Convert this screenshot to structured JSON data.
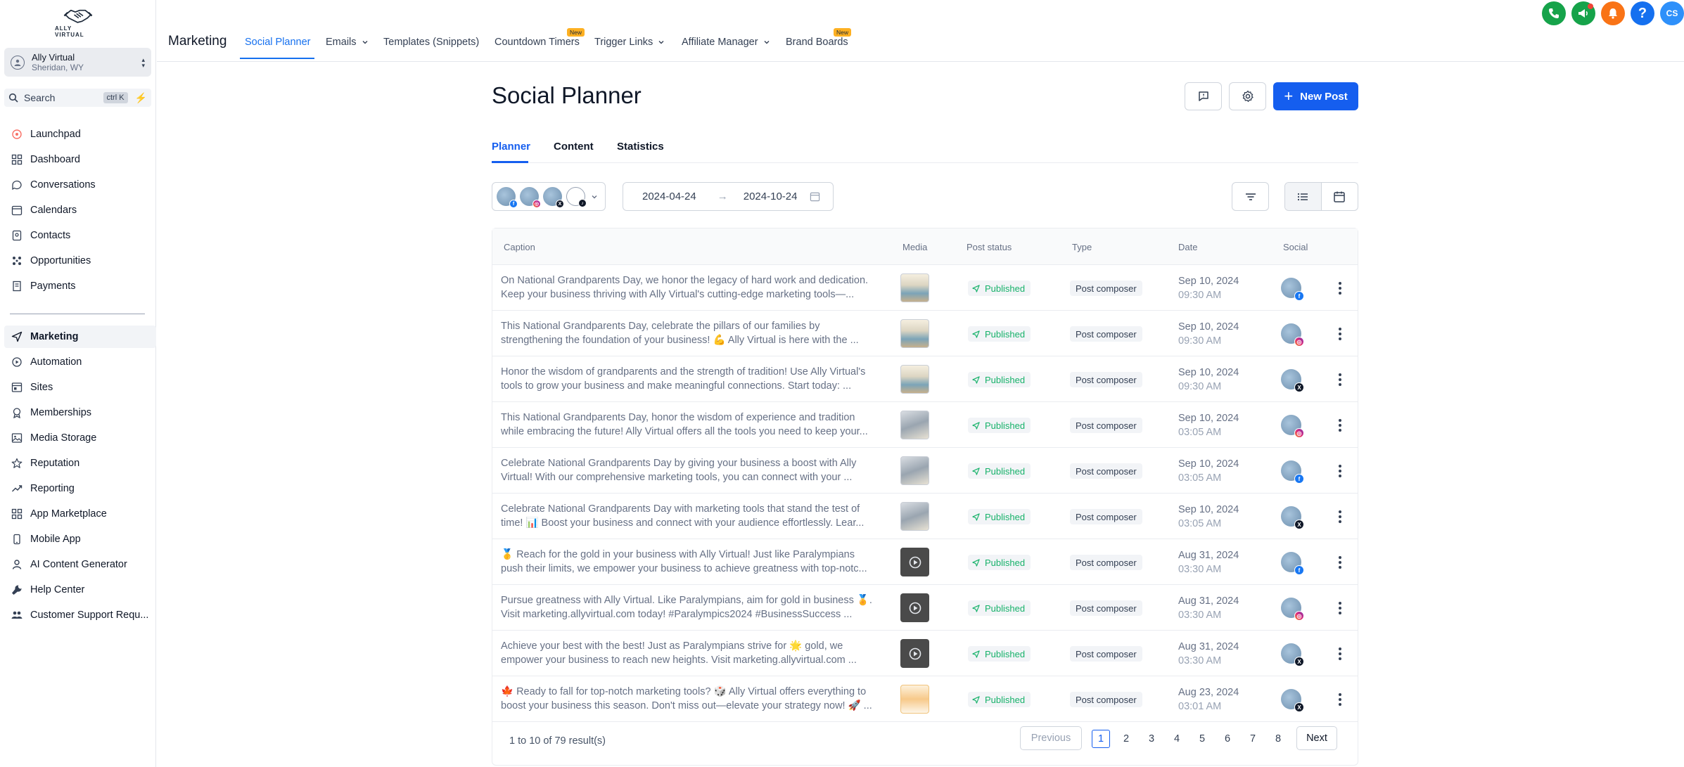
{
  "brand": {
    "logo_text": "ALLY VIRTUAL"
  },
  "account": {
    "name": "Ally Virtual",
    "location": "Sheridan, WY"
  },
  "search": {
    "label": "Search",
    "shortcut": "ctrl K"
  },
  "sidebar": {
    "items": [
      {
        "label": "Launchpad",
        "icon": "rocket-icon"
      },
      {
        "label": "Dashboard",
        "icon": "grid-icon"
      },
      {
        "label": "Conversations",
        "icon": "chat-icon"
      },
      {
        "label": "Calendars",
        "icon": "calendar-icon"
      },
      {
        "label": "Contacts",
        "icon": "contacts-icon"
      },
      {
        "label": "Opportunities",
        "icon": "opportunities-icon"
      },
      {
        "label": "Payments",
        "icon": "payments-icon"
      },
      {
        "label": "Marketing",
        "icon": "send-icon"
      },
      {
        "label": "Automation",
        "icon": "automation-icon"
      },
      {
        "label": "Sites",
        "icon": "sites-icon"
      },
      {
        "label": "Memberships",
        "icon": "memberships-icon"
      },
      {
        "label": "Media Storage",
        "icon": "image-icon"
      },
      {
        "label": "Reputation",
        "icon": "star-icon"
      },
      {
        "label": "Reporting",
        "icon": "trend-icon"
      },
      {
        "label": "App Marketplace",
        "icon": "apps-icon"
      },
      {
        "label": "Mobile App",
        "icon": "mobile-icon"
      },
      {
        "label": "AI Content Generator",
        "icon": "ai-icon"
      },
      {
        "label": "Help Center",
        "icon": "wrench-icon"
      },
      {
        "label": "Customer Support Requ...",
        "icon": "support-icon"
      }
    ],
    "active": "Marketing"
  },
  "topnav": {
    "module": "Marketing",
    "tabs": [
      {
        "label": "Social Planner"
      },
      {
        "label": "Emails"
      },
      {
        "label": "Templates (Snippets)"
      },
      {
        "label": "Countdown Timers"
      },
      {
        "label": "Trigger Links"
      },
      {
        "label": "Affiliate Manager"
      },
      {
        "label": "Brand Boards"
      }
    ],
    "new_badge": "New",
    "user_initials": "CS"
  },
  "page": {
    "title": "Social Planner",
    "new_post": "New Post",
    "subtabs": [
      "Planner",
      "Content",
      "Statistics"
    ],
    "date_start": "2024-04-24",
    "date_end": "2024-10-24"
  },
  "table": {
    "columns": [
      "Caption",
      "Media",
      "Post status",
      "Type",
      "Date",
      "Social"
    ],
    "rows": [
      {
        "caption1": "On National Grandparents Day, we honor the legacy of hard work and dedication.",
        "caption2": "Keep your business thriving with Ally Virtual's cutting-edge marketing tools—...",
        "media": "image",
        "status": "Published",
        "type": "Post composer",
        "date": "Sep 10, 2024",
        "time": "09:30 AM",
        "network": "fb"
      },
      {
        "caption1": "This National Grandparents Day, celebrate the pillars of our families by",
        "caption2": "strengthening the foundation of your business! 💪 Ally Virtual is here with the ...",
        "media": "image",
        "status": "Published",
        "type": "Post composer",
        "date": "Sep 10, 2024",
        "time": "09:30 AM",
        "network": "ig"
      },
      {
        "caption1": "Honor the wisdom of grandparents and the strength of tradition! Use Ally Virtual's",
        "caption2": "tools to grow your business and make meaningful connections. Start today: ...",
        "media": "image",
        "status": "Published",
        "type": "Post composer",
        "date": "Sep 10, 2024",
        "time": "09:30 AM",
        "network": "x"
      },
      {
        "caption1": "This National Grandparents Day, honor the wisdom of experience and tradition",
        "caption2": "while embracing the future! Ally Virtual offers all the tools you need to keep your...",
        "media": "image2",
        "status": "Published",
        "type": "Post composer",
        "date": "Sep 10, 2024",
        "time": "03:05 AM",
        "network": "ig"
      },
      {
        "caption1": "Celebrate National Grandparents Day by giving your business a boost with Ally",
        "caption2": "Virtual! With our comprehensive marketing tools, you can connect with your ...",
        "media": "image2",
        "status": "Published",
        "type": "Post composer",
        "date": "Sep 10, 2024",
        "time": "03:05 AM",
        "network": "fb"
      },
      {
        "caption1": "Celebrate National Grandparents Day with marketing tools that stand the test of",
        "caption2": "time! 📊 Boost your business and connect with your audience effortlessly. Lear...",
        "media": "image2",
        "status": "Published",
        "type": "Post composer",
        "date": "Sep 10, 2024",
        "time": "03:05 AM",
        "network": "x"
      },
      {
        "caption1": "🥇 Reach for the gold in your business with Ally Virtual! Just like Paralympians",
        "caption2": "push their limits, we empower your business to achieve greatness with top-notc...",
        "media": "video",
        "status": "Published",
        "type": "Post composer",
        "date": "Aug 31, 2024",
        "time": "03:30 AM",
        "network": "fb"
      },
      {
        "caption1": "Pursue greatness with Ally Virtual. Like Paralympians, aim for gold in business 🏅.",
        "caption2": "Visit marketing.allyvirtual.com today! #Paralympics2024 #BusinessSuccess ...",
        "media": "video",
        "status": "Published",
        "type": "Post composer",
        "date": "Aug 31, 2024",
        "time": "03:30 AM",
        "network": "ig"
      },
      {
        "caption1": "Achieve your best with the best! Just as Paralympians strive for 🌟 gold, we",
        "caption2": "empower your business to reach new heights. Visit marketing.allyvirtual.com ...",
        "media": "video",
        "status": "Published",
        "type": "Post composer",
        "date": "Aug 31, 2024",
        "time": "03:30 AM",
        "network": "x"
      },
      {
        "caption1": "🍁 Ready to fall for top-notch marketing tools? 🎲 Ally Virtual offers everything to",
        "caption2": "boost your business this season. Don't miss out—elevate your strategy now! 🚀 ...",
        "media": "orange",
        "status": "Published",
        "type": "Post composer",
        "date": "Aug 23, 2024",
        "time": "03:01 AM",
        "network": "x"
      }
    ]
  },
  "pagination": {
    "summary": "1 to 10 of 79 result(s)",
    "previous": "Previous",
    "next": "Next",
    "pages": [
      "1",
      "2",
      "3",
      "4",
      "5",
      "6",
      "7",
      "8"
    ],
    "current": "1"
  },
  "colors": {
    "accent": "#155eef",
    "published": "#17b26a",
    "phone": "#16a34a",
    "notify": "#f97316",
    "help": "#1570ef",
    "avatar": "#2e90fa"
  }
}
